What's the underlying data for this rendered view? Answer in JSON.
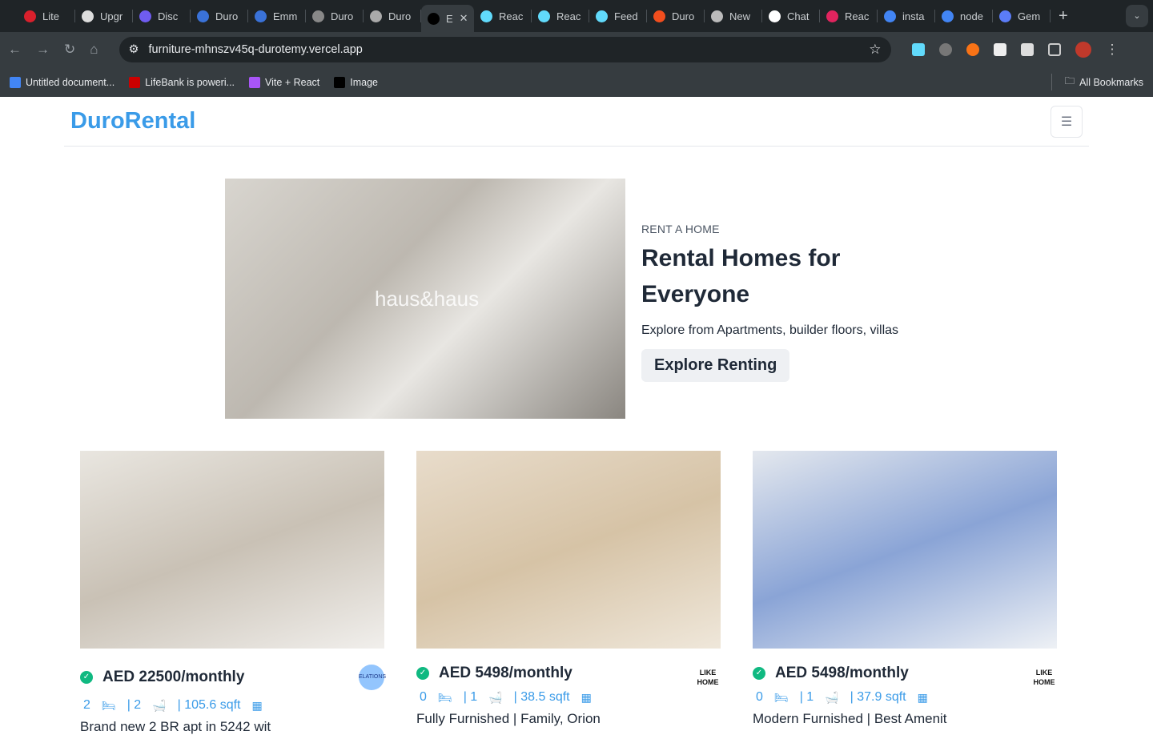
{
  "browser": {
    "tabs": [
      {
        "label": "Lite",
        "color": "#d9202c"
      },
      {
        "label": "Upgr",
        "color": "#ddd"
      },
      {
        "label": "Disc",
        "color": "#6f5cf0"
      },
      {
        "label": "Duro",
        "color": "#3a72d8"
      },
      {
        "label": "Emm",
        "color": "#3a72d8"
      },
      {
        "label": "Duro",
        "color": "#888"
      },
      {
        "label": "Duro",
        "color": "#aaa"
      },
      {
        "label": "E",
        "color": "#000",
        "active": true
      },
      {
        "label": "Reac",
        "color": "#61dafb"
      },
      {
        "label": "Reac",
        "color": "#61dafb"
      },
      {
        "label": "Feed",
        "color": "#61dafb"
      },
      {
        "label": "Duro",
        "color": "#f24e1e"
      },
      {
        "label": "New",
        "color": "#bbb"
      },
      {
        "label": "Chat",
        "color": "#fff"
      },
      {
        "label": "Reac",
        "color": "#e0245e"
      },
      {
        "label": "insta",
        "color": "#4285f4"
      },
      {
        "label": "node",
        "color": "#4285f4"
      },
      {
        "label": "Gem",
        "color": "#5b7cf7"
      }
    ],
    "url": "furniture-mhnszv45q-durotemy.vercel.app",
    "bookmarks": [
      {
        "label": "Untitled document...",
        "color": "#4285f4"
      },
      {
        "label": "LifeBank is poweri...",
        "color": "#cc0000"
      },
      {
        "label": "Vite + React",
        "color": "#a855f7"
      },
      {
        "label": "Image",
        "color": "#000"
      }
    ],
    "all_bookmarks": "All Bookmarks"
  },
  "nav": {
    "brand": "DuroRental"
  },
  "hero": {
    "watermark": "haus&haus",
    "eyebrow": "RENT A HOME",
    "title": "Rental Homes for Everyone",
    "subtitle": "Explore from Apartments, builder floors, villas",
    "cta": "Explore Renting"
  },
  "listings": [
    {
      "price": "AED 22500/monthly",
      "beds": "2",
      "baths": "| 2",
      "area": "| 105.6 sqft",
      "desc": "Brand new 2 BR apt in 5242 wit",
      "agency": "ELATIONS",
      "img": "linear-gradient(160deg,#e9e6e0,#c9c1b5 50%,#f1efec)"
    },
    {
      "price": "AED 5498/monthly",
      "beds": "0",
      "baths": "| 1",
      "area": "| 38.5 sqft",
      "desc": "Fully Furnished | Family, Orion",
      "agency": "LIKE HOME",
      "img": "linear-gradient(160deg,#e8dccb,#d6c3a6 50%,#efe7da)"
    },
    {
      "price": "AED 5498/monthly",
      "beds": "0",
      "baths": "| 1",
      "area": "| 37.9 sqft",
      "desc": "Modern Furnished | Best Amenit",
      "agency": "LIKE HOME",
      "img": "linear-gradient(160deg,#e4e8ee,#8aa4d6 50%,#eef1f5)"
    }
  ]
}
